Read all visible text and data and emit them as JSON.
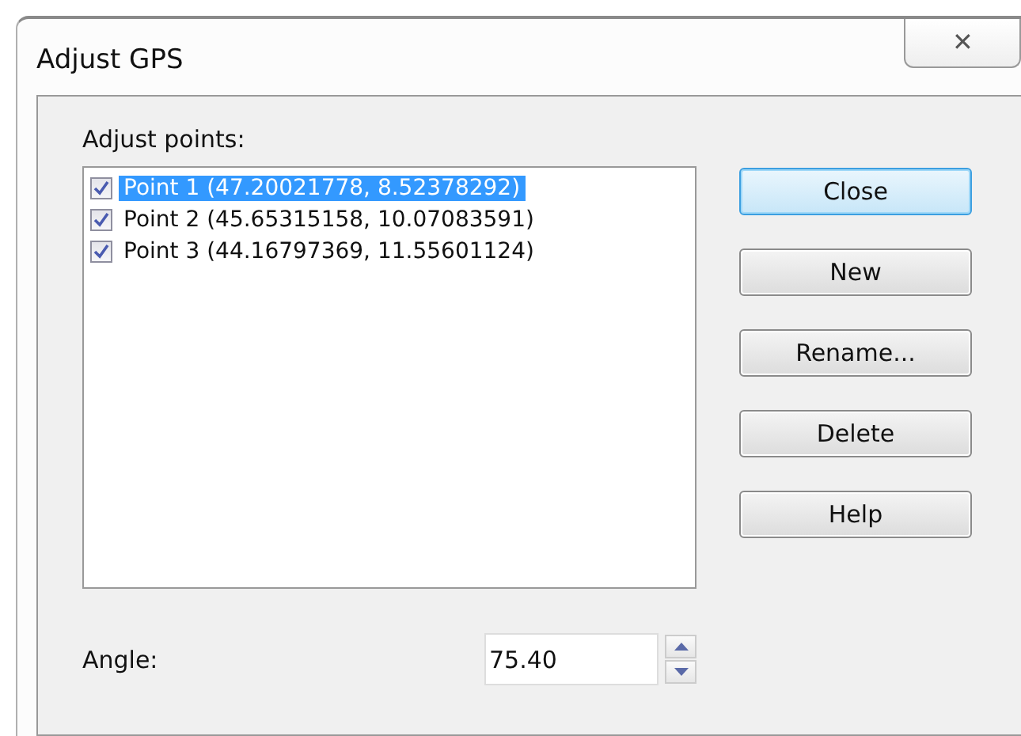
{
  "window": {
    "title": "Adjust GPS",
    "close_symbol": "✕"
  },
  "list": {
    "label": "Adjust points:",
    "items": [
      {
        "text": "Point 1 (47.20021778, 8.52378292)",
        "checked": true,
        "selected": true
      },
      {
        "text": "Point 2 (45.65315158, 10.07083591)",
        "checked": true,
        "selected": false
      },
      {
        "text": "Point 3 (44.16797369, 11.55601124)",
        "checked": true,
        "selected": false
      }
    ]
  },
  "buttons": [
    {
      "label": "Close",
      "default": true
    },
    {
      "label": "New",
      "default": false
    },
    {
      "label": "Rename...",
      "default": false
    },
    {
      "label": "Delete",
      "default": false
    },
    {
      "label": "Help",
      "default": false
    }
  ],
  "angle": {
    "label": "Angle:",
    "value": "75.40"
  }
}
